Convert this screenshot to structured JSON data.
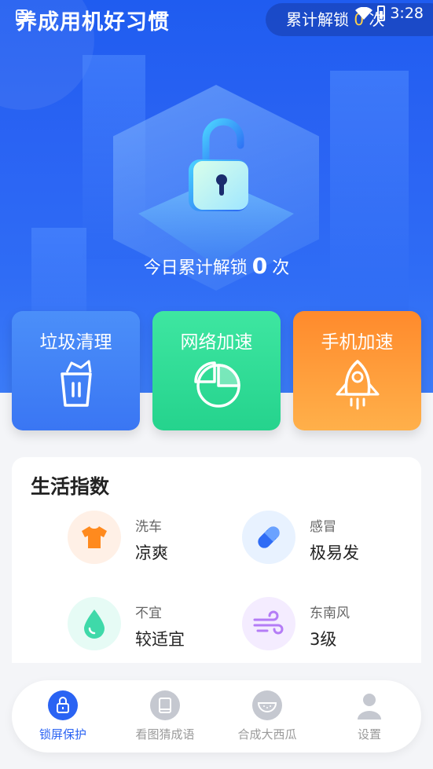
{
  "status_bar": {
    "time": "3:28"
  },
  "header": {
    "app_title": "养成用机好习惯",
    "unlock_prefix": "累计解锁",
    "unlock_count": "0",
    "unlock_suffix": "次"
  },
  "hero": {
    "today_prefix": "今日累计解锁",
    "today_count": "0",
    "today_suffix": "次"
  },
  "cards": [
    {
      "label": "垃圾清理",
      "icon": "trash-icon"
    },
    {
      "label": "网络加速",
      "icon": "pie-chart-icon"
    },
    {
      "label": "手机加速",
      "icon": "rocket-icon"
    }
  ],
  "life": {
    "title": "生活指数",
    "items": [
      {
        "name": "洗车",
        "value": "凉爽",
        "icon": "shirt-icon",
        "color": "#fff0e6",
        "accent": "#ff8a1e"
      },
      {
        "name": "感冒",
        "value": "极易发",
        "icon": "pill-icon",
        "color": "#e8f2ff",
        "accent": "#2f6cf5"
      },
      {
        "name": "不宜",
        "value": "较适宜",
        "icon": "water-drop-icon",
        "color": "#e6fbf5",
        "accent": "#3fd9a9"
      },
      {
        "name": "东南风",
        "value": "3级",
        "icon": "wind-icon",
        "color": "#f4ecff",
        "accent": "#b47cf6"
      }
    ]
  },
  "tabbar": {
    "tabs": [
      {
        "label": "锁屏保护",
        "icon": "lock-icon",
        "active": true
      },
      {
        "label": "看图猜成语",
        "icon": "book-icon",
        "active": false
      },
      {
        "label": "合成大西瓜",
        "icon": "watermelon-icon",
        "active": false
      },
      {
        "label": "设置",
        "icon": "user-icon",
        "active": false
      }
    ]
  },
  "colors": {
    "primary": "#2a63f3",
    "trash_card": "#3a76f3",
    "net_card": "#25d38d",
    "phone_card": "#ff9a3a",
    "highlight": "#ffd24a"
  }
}
